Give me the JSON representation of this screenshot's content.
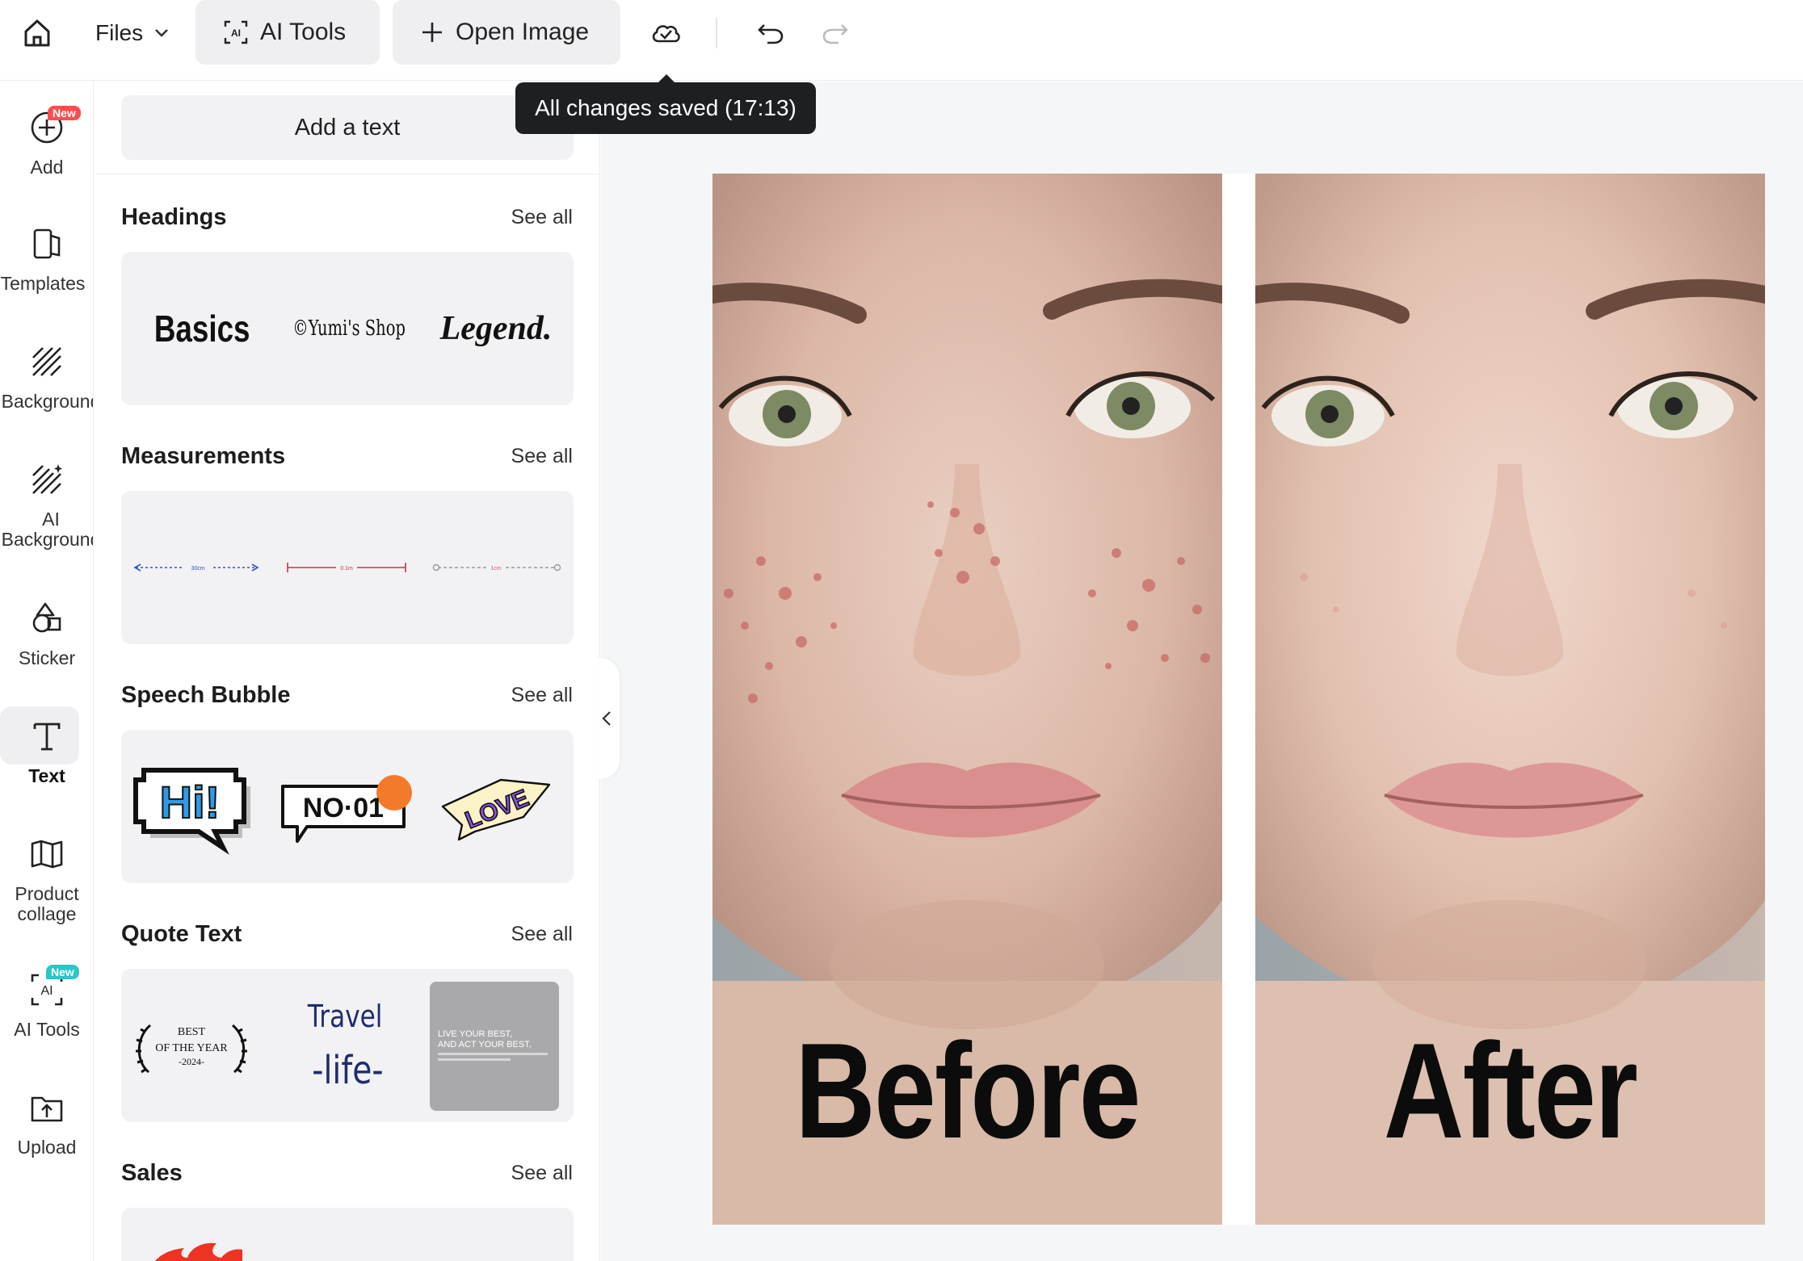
{
  "topbar": {
    "files_label": "Files",
    "ai_tools_label": "AI Tools",
    "open_image_label": "Open Image"
  },
  "tooltip": {
    "text": "All changes saved (17:13)"
  },
  "rail": {
    "items": [
      {
        "label": "Add",
        "icon": "add-circle-icon",
        "badge": "New"
      },
      {
        "label": "Templates",
        "icon": "templates-icon"
      },
      {
        "label": "Background",
        "icon": "background-hatch-icon"
      },
      {
        "label": "AI\nBackground",
        "icon": "ai-background-icon"
      },
      {
        "label": "Sticker",
        "icon": "sticker-icon"
      },
      {
        "label": "Text",
        "icon": "text-t-icon",
        "active": true
      },
      {
        "label": "Product\ncollage",
        "icon": "collage-icon"
      },
      {
        "label": "AI Tools",
        "icon": "ai-tools-icon",
        "badge": "New"
      },
      {
        "label": "Upload",
        "icon": "upload-icon"
      }
    ]
  },
  "panel": {
    "add_text_label": "Add a text",
    "see_all_label": "See all",
    "sections": [
      {
        "title": "Headings"
      },
      {
        "title": "Measurements"
      },
      {
        "title": "Speech Bubble"
      },
      {
        "title": "Quote Text"
      },
      {
        "title": "Sales"
      }
    ],
    "heading_samples": [
      "Basics",
      "©Yumi's Shop",
      "Legend."
    ],
    "measure_samples": [
      "30cm",
      "0.1m",
      "1cm"
    ],
    "bubble_samples": [
      "Hi!",
      "NO·01",
      "LOVE"
    ],
    "quote_samples": {
      "laurel": [
        "BEST",
        "OF THE YEAR",
        "-2024-"
      ],
      "travel": [
        "Travel",
        "-life-"
      ],
      "card": [
        "LIVE YOUR BEST,",
        "AND ACT YOUR BEST,"
      ]
    }
  },
  "canvas": {
    "before_label": "Before",
    "after_label": "After"
  }
}
